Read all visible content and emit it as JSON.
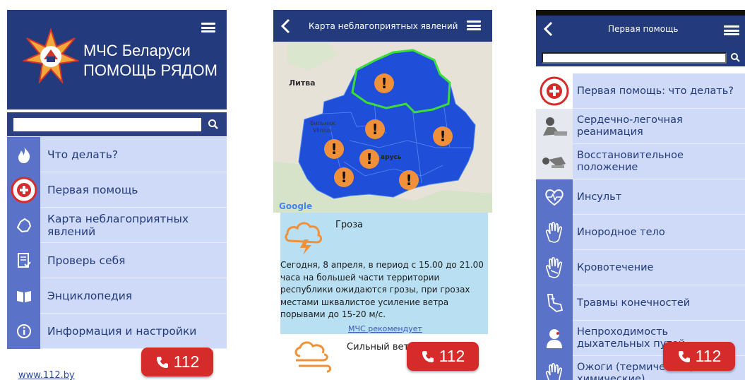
{
  "screen1": {
    "title_line1": "МЧС Беларуси",
    "title_line2": "ПОМОЩЬ РЯДОМ",
    "search": {
      "placeholder": ""
    },
    "items": [
      {
        "label": "Что делать?",
        "icon": "fire-icon"
      },
      {
        "label": "Первая помощь",
        "icon": "first-aid-emblem-icon"
      },
      {
        "label": "Карта неблагоприятных явлений",
        "icon": "map-outline-icon"
      },
      {
        "label": "Проверь себя",
        "icon": "checklist-icon"
      },
      {
        "label": "Энциклопедия",
        "icon": "book-icon"
      },
      {
        "label": "Информация и настройки",
        "icon": "info-icon"
      }
    ],
    "footer_link": "www.112.by",
    "call_button": "112"
  },
  "screen2": {
    "title": "Карта неблагоприятных явлений",
    "map_labels": {
      "lithuania": "Литва",
      "vilnius_line1": "Вильнюс",
      "vilnius_line2": "Vilnius",
      "belarus_partial": "арусь",
      "google": "Google"
    },
    "alert": {
      "title": "Гроза",
      "text": "Сегодня, 8 апреля, в период с 15.00 до 21.00 часа на большей части территории республики ожидаются грозы, при грозах местами шквалистое усиление ветра порывами до 15-20 м/с.",
      "link": "МЧС рекомендует"
    },
    "alert2_title": "Сильный ветер",
    "call_button": "112",
    "colors": {
      "region_fill": "#1f4fd8",
      "highlight_region": "#3bdc3b",
      "warning_marker": "#f0913a"
    }
  },
  "screen3": {
    "title": "Первая помощь",
    "search": {
      "placeholder": ""
    },
    "items": [
      {
        "label": "Первая помощь: что делать?",
        "icon": "first-aid-emblem-icon"
      },
      {
        "label": "Сердечно-легочная реанимация",
        "icon": "cpr-icon"
      },
      {
        "label": "Восстановительное положение",
        "icon": "recovery-position-icon"
      },
      {
        "label": "Инсульт",
        "icon": "heart-pulse-icon"
      },
      {
        "label": "Инородное тело",
        "icon": "hand-icon"
      },
      {
        "label": "Кровотечение",
        "icon": "bleeding-hand-icon"
      },
      {
        "label": "Травмы конечностей",
        "icon": "limb-injury-icon"
      },
      {
        "label": "Непроходимость дыхательных путей",
        "icon": "airway-icon"
      },
      {
        "label": "Ожоги (термические, химические)",
        "icon": "burn-hand-icon"
      }
    ],
    "call_button": "112"
  },
  "colors": {
    "header": "#233a7c",
    "item_bg": "#cfdaf9",
    "icon_bg": "#5b72c9",
    "call_button": "#d62b2b"
  }
}
